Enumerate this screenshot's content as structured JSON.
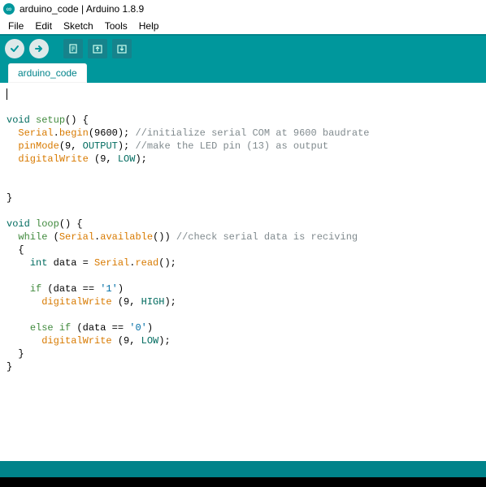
{
  "window": {
    "title": "arduino_code | Arduino 1.8.9"
  },
  "menu": {
    "file": "File",
    "edit": "Edit",
    "sketch": "Sketch",
    "tools": "Tools",
    "help": "Help"
  },
  "toolbar": {
    "verify": "verify",
    "upload": "upload",
    "new": "new",
    "open": "open",
    "save": "save"
  },
  "tabs": {
    "active": "arduino_code"
  },
  "code": {
    "tokens": [
      {
        "cls": "cursor",
        "t": ""
      },
      {
        "cls": "",
        "t": "\n\n"
      },
      {
        "cls": "kw",
        "t": "void"
      },
      {
        "cls": "",
        "t": " "
      },
      {
        "cls": "ctr",
        "t": "setup"
      },
      {
        "cls": "",
        "t": "() {\n"
      },
      {
        "cls": "",
        "t": "  "
      },
      {
        "cls": "sys",
        "t": "Serial"
      },
      {
        "cls": "",
        "t": "."
      },
      {
        "cls": "sys",
        "t": "begin"
      },
      {
        "cls": "",
        "t": "(9600); "
      },
      {
        "cls": "cmt",
        "t": "//initialize serial COM at 9600 baudrate"
      },
      {
        "cls": "",
        "t": "\n"
      },
      {
        "cls": "",
        "t": "  "
      },
      {
        "cls": "sys",
        "t": "pinMode"
      },
      {
        "cls": "",
        "t": "(9, "
      },
      {
        "cls": "cst",
        "t": "OUTPUT"
      },
      {
        "cls": "",
        "t": "); "
      },
      {
        "cls": "cmt",
        "t": "//make the LED pin (13) as output"
      },
      {
        "cls": "",
        "t": "\n"
      },
      {
        "cls": "",
        "t": "  "
      },
      {
        "cls": "sys",
        "t": "digitalWrite"
      },
      {
        "cls": "",
        "t": " (9, "
      },
      {
        "cls": "cst",
        "t": "LOW"
      },
      {
        "cls": "",
        "t": ");\n"
      },
      {
        "cls": "",
        "t": "\n\n"
      },
      {
        "cls": "",
        "t": "}\n"
      },
      {
        "cls": "",
        "t": "\n"
      },
      {
        "cls": "kw",
        "t": "void"
      },
      {
        "cls": "",
        "t": " "
      },
      {
        "cls": "ctr",
        "t": "loop"
      },
      {
        "cls": "",
        "t": "() {\n"
      },
      {
        "cls": "",
        "t": "  "
      },
      {
        "cls": "ctr",
        "t": "while"
      },
      {
        "cls": "",
        "t": " ("
      },
      {
        "cls": "sys",
        "t": "Serial"
      },
      {
        "cls": "",
        "t": "."
      },
      {
        "cls": "sys",
        "t": "available"
      },
      {
        "cls": "",
        "t": "()) "
      },
      {
        "cls": "cmt",
        "t": "//check serial data is reciving"
      },
      {
        "cls": "",
        "t": "\n"
      },
      {
        "cls": "",
        "t": "  {\n"
      },
      {
        "cls": "",
        "t": "    "
      },
      {
        "cls": "kw",
        "t": "int"
      },
      {
        "cls": "",
        "t": " data = "
      },
      {
        "cls": "sys",
        "t": "Serial"
      },
      {
        "cls": "",
        "t": "."
      },
      {
        "cls": "sys",
        "t": "read"
      },
      {
        "cls": "",
        "t": "();\n"
      },
      {
        "cls": "",
        "t": "\n"
      },
      {
        "cls": "",
        "t": "    "
      },
      {
        "cls": "ctr",
        "t": "if"
      },
      {
        "cls": "",
        "t": " (data == "
      },
      {
        "cls": "str",
        "t": "'1'"
      },
      {
        "cls": "",
        "t": ")\n"
      },
      {
        "cls": "",
        "t": "      "
      },
      {
        "cls": "sys",
        "t": "digitalWrite"
      },
      {
        "cls": "",
        "t": " (9, "
      },
      {
        "cls": "cst",
        "t": "HIGH"
      },
      {
        "cls": "",
        "t": ");\n"
      },
      {
        "cls": "",
        "t": "\n"
      },
      {
        "cls": "",
        "t": "    "
      },
      {
        "cls": "ctr",
        "t": "else"
      },
      {
        "cls": "",
        "t": " "
      },
      {
        "cls": "ctr",
        "t": "if"
      },
      {
        "cls": "",
        "t": " (data == "
      },
      {
        "cls": "str",
        "t": "'0'"
      },
      {
        "cls": "",
        "t": ")\n"
      },
      {
        "cls": "",
        "t": "      "
      },
      {
        "cls": "sys",
        "t": "digitalWrite"
      },
      {
        "cls": "",
        "t": " (9, "
      },
      {
        "cls": "cst",
        "t": "LOW"
      },
      {
        "cls": "",
        "t": ");\n"
      },
      {
        "cls": "",
        "t": "  }\n"
      },
      {
        "cls": "",
        "t": "}\n"
      }
    ]
  }
}
